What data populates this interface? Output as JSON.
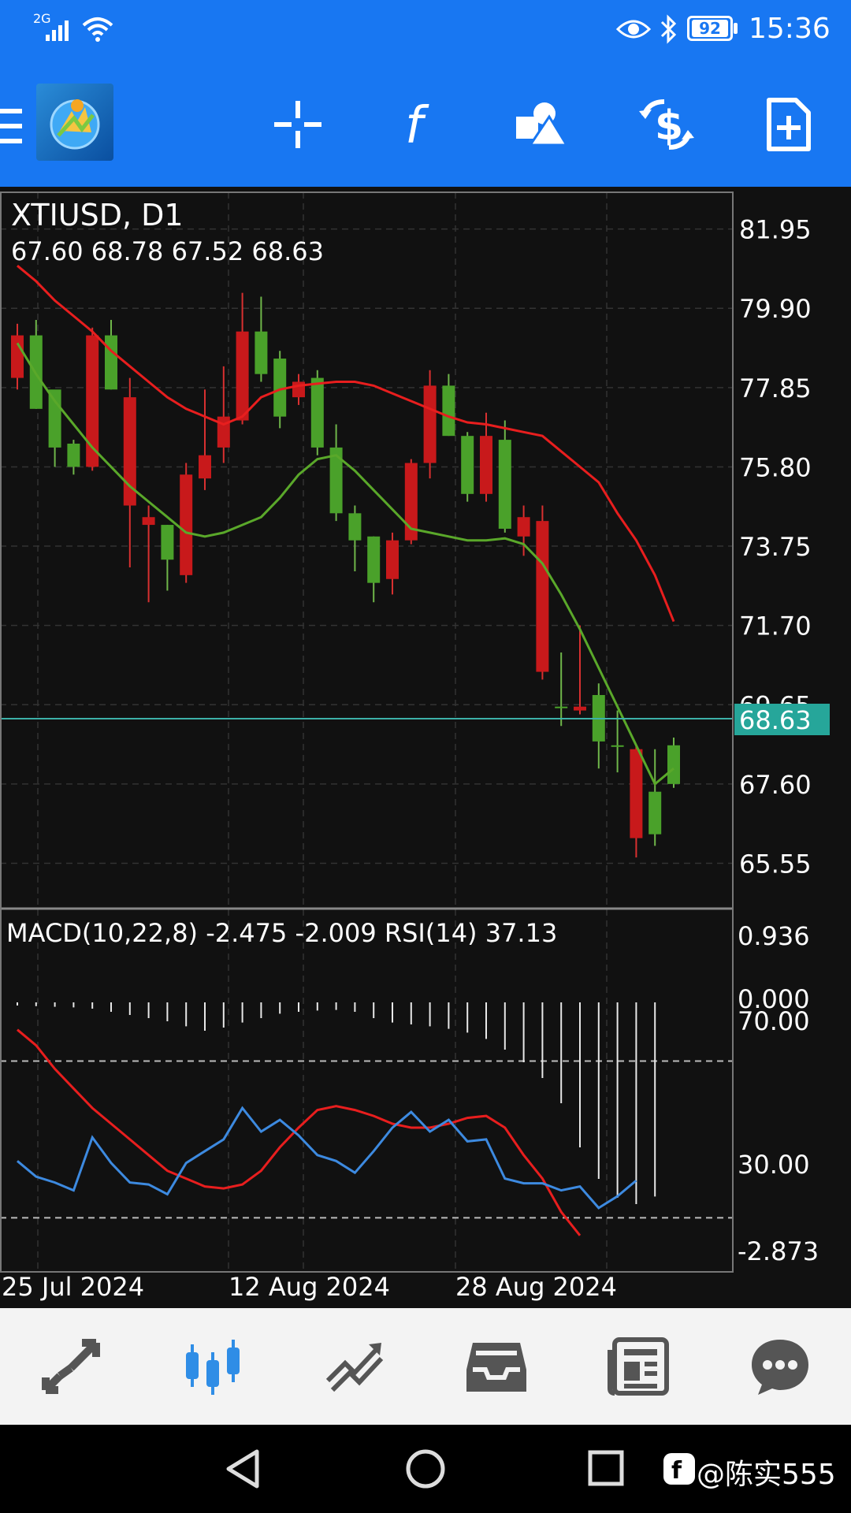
{
  "status_bar": {
    "network": "2G",
    "battery": "92",
    "time": "15:36"
  },
  "chart": {
    "symbol_timeframe": "XTIUSD, D1",
    "ohlc": "67.60 68.78 67.52 68.63",
    "current_price": "68.63",
    "price_ticks": [
      "81.95",
      "79.90",
      "77.85",
      "75.80",
      "73.75",
      "71.70",
      "69.65",
      "67.60",
      "65.55"
    ],
    "indicator_label": "MACD(10,22,8) -2.475 -2.009 RSI(14) 37.13",
    "indicator_ticks": [
      "0.936",
      "0.000",
      "70.00",
      "30.00",
      "-2.873"
    ],
    "date_labels": [
      "25 Jul 2024",
      "12 Aug 2024",
      "28 Aug 2024"
    ]
  },
  "watermark": "@陈实555",
  "chart_data": {
    "type": "candlestick",
    "ylim": [
      64.5,
      82.9
    ],
    "candles": [
      {
        "o": 79.2,
        "h": 79.5,
        "l": 77.8,
        "c": 78.1
      },
      {
        "o": 77.3,
        "h": 79.6,
        "l": 77.3,
        "c": 79.2
      },
      {
        "o": 76.3,
        "h": 77.7,
        "l": 75.8,
        "c": 77.8
      },
      {
        "o": 75.8,
        "h": 76.5,
        "l": 75.6,
        "c": 76.4
      },
      {
        "o": 79.2,
        "h": 79.4,
        "l": 75.7,
        "c": 75.8
      },
      {
        "o": 77.8,
        "h": 79.6,
        "l": 77.8,
        "c": 79.2
      },
      {
        "o": 77.6,
        "h": 78.1,
        "l": 73.2,
        "c": 74.8
      },
      {
        "o": 74.5,
        "h": 74.8,
        "l": 72.3,
        "c": 74.3
      },
      {
        "o": 73.4,
        "h": 74.3,
        "l": 72.6,
        "c": 74.3
      },
      {
        "o": 75.6,
        "h": 75.9,
        "l": 72.8,
        "c": 73.0
      },
      {
        "o": 76.1,
        "h": 77.8,
        "l": 75.2,
        "c": 75.5
      },
      {
        "o": 77.1,
        "h": 78.4,
        "l": 75.9,
        "c": 76.3
      },
      {
        "o": 79.3,
        "h": 80.3,
        "l": 76.9,
        "c": 77.0
      },
      {
        "o": 78.2,
        "h": 80.2,
        "l": 78.0,
        "c": 79.3
      },
      {
        "o": 77.1,
        "h": 78.8,
        "l": 76.8,
        "c": 78.6
      },
      {
        "o": 78.0,
        "h": 78.2,
        "l": 77.4,
        "c": 77.6
      },
      {
        "o": 76.3,
        "h": 78.3,
        "l": 76.1,
        "c": 78.1
      },
      {
        "o": 74.6,
        "h": 76.9,
        "l": 74.4,
        "c": 76.3
      },
      {
        "o": 73.9,
        "h": 74.8,
        "l": 73.1,
        "c": 74.6
      },
      {
        "o": 72.8,
        "h": 74.0,
        "l": 72.3,
        "c": 74.0
      },
      {
        "o": 73.9,
        "h": 74.1,
        "l": 72.5,
        "c": 72.9
      },
      {
        "o": 75.9,
        "h": 76.0,
        "l": 73.8,
        "c": 73.9
      },
      {
        "o": 77.9,
        "h": 78.3,
        "l": 75.5,
        "c": 75.9
      },
      {
        "o": 76.6,
        "h": 78.2,
        "l": 76.6,
        "c": 77.9
      },
      {
        "o": 75.1,
        "h": 76.7,
        "l": 74.9,
        "c": 76.6
      },
      {
        "o": 76.6,
        "h": 77.2,
        "l": 74.9,
        "c": 75.1
      },
      {
        "o": 74.2,
        "h": 77.0,
        "l": 74.1,
        "c": 76.5
      },
      {
        "o": 74.5,
        "h": 74.8,
        "l": 73.5,
        "c": 74.0
      },
      {
        "o": 74.4,
        "h": 74.8,
        "l": 70.3,
        "c": 70.5
      },
      {
        "o": 69.6,
        "h": 71.0,
        "l": 69.1,
        "c": 69.6
      },
      {
        "o": 69.6,
        "h": 71.7,
        "l": 69.4,
        "c": 69.5
      },
      {
        "o": 68.7,
        "h": 70.2,
        "l": 68.0,
        "c": 69.9
      },
      {
        "o": 68.6,
        "h": 69.5,
        "l": 67.9,
        "c": 68.6
      },
      {
        "o": 68.5,
        "h": 68.6,
        "l": 65.7,
        "c": 66.2
      },
      {
        "o": 66.3,
        "h": 68.5,
        "l": 66.0,
        "c": 67.4
      },
      {
        "o": 67.6,
        "h": 68.8,
        "l": 67.5,
        "c": 68.6
      }
    ],
    "ma_red": [
      81.0,
      80.6,
      80.1,
      79.7,
      79.3,
      78.8,
      78.4,
      78.0,
      77.6,
      77.3,
      77.1,
      76.9,
      77.1,
      77.6,
      77.8,
      77.9,
      77.95,
      78.0,
      78.0,
      77.9,
      77.7,
      77.5,
      77.3,
      77.1,
      76.95,
      76.9,
      76.8,
      76.7,
      76.6,
      76.2,
      75.8,
      75.4,
      74.6,
      73.9,
      73.0,
      71.8
    ],
    "ma_green": [
      79.0,
      78.2,
      77.5,
      76.9,
      76.3,
      75.8,
      75.3,
      74.9,
      74.5,
      74.1,
      74.0,
      74.1,
      74.3,
      74.5,
      75.0,
      75.6,
      76.0,
      76.1,
      75.7,
      75.2,
      74.7,
      74.2,
      74.1,
      74.0,
      73.9,
      73.9,
      73.95,
      73.8,
      73.3,
      72.5,
      71.6,
      70.6,
      69.6,
      68.6,
      67.6,
      68.0
    ],
    "rsi_ylim": [
      16,
      90
    ],
    "rsi": [
      44.5,
      40.5,
      39,
      37,
      50.5,
      44,
      39,
      38.5,
      36,
      44,
      47,
      50,
      58,
      52,
      55,
      51,
      46,
      44.5,
      41.5,
      47,
      53,
      57,
      52,
      55,
      49.5,
      50,
      40,
      38.8,
      38.8,
      37,
      38,
      32.5,
      35.5,
      39.5
    ],
    "macd_signal": [
      78,
      74,
      68,
      63,
      58,
      54,
      50,
      46,
      42,
      40,
      38,
      37.5,
      38.5,
      42,
      48,
      53,
      57.5,
      58.5,
      57.5,
      56,
      54,
      53,
      53,
      54,
      55.5,
      56,
      53,
      46,
      40,
      31.5,
      25.5
    ],
    "macd_hist": [
      0.55,
      0.54,
      0.53,
      0.52,
      0.5,
      0.45,
      0.4,
      0.35,
      0.3,
      0.22,
      0.15,
      0.2,
      0.28,
      0.35,
      0.42,
      0.45,
      0.47,
      0.48,
      0.45,
      0.35,
      0.28,
      0.25,
      0.22,
      0.18,
      0.12,
      0.02,
      -0.15,
      -0.35,
      -0.6,
      -1.0,
      -1.7,
      -2.2,
      -2.5,
      -2.6,
      -2.48
    ]
  }
}
